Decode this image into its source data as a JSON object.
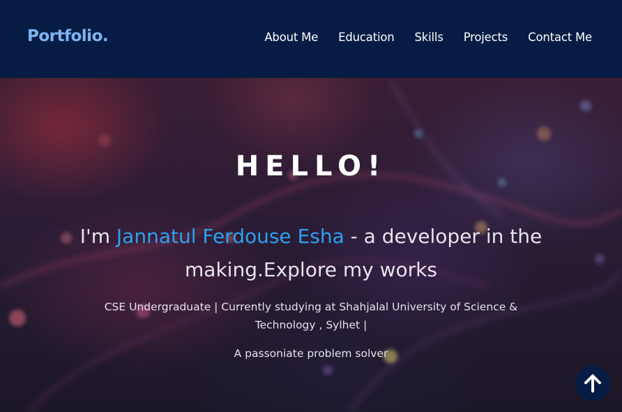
{
  "navbar": {
    "logo": "Portfolio.",
    "links": [
      {
        "label": "About Me"
      },
      {
        "label": "Education"
      },
      {
        "label": "Skills"
      },
      {
        "label": "Projects"
      },
      {
        "label": "Contact Me"
      }
    ]
  },
  "hero": {
    "greeting": "HELLO!",
    "intro_prefix": "I'm ",
    "name": "Jannatul Ferdouse Esha",
    "intro_suffix": " - a developer in the making.Explore my works",
    "education": "CSE Undergraduate | Currently studying at Shahjalal University of Science & Technology , Sylhet |",
    "tagline": "A passoniate problem solver"
  },
  "scroll_top": {
    "icon": "arrow-up-icon"
  },
  "colors": {
    "navbar_bg": "#071c44",
    "logo": "#7fb3f2",
    "name_accent": "#2aa2f0",
    "text": "#ffffff"
  }
}
